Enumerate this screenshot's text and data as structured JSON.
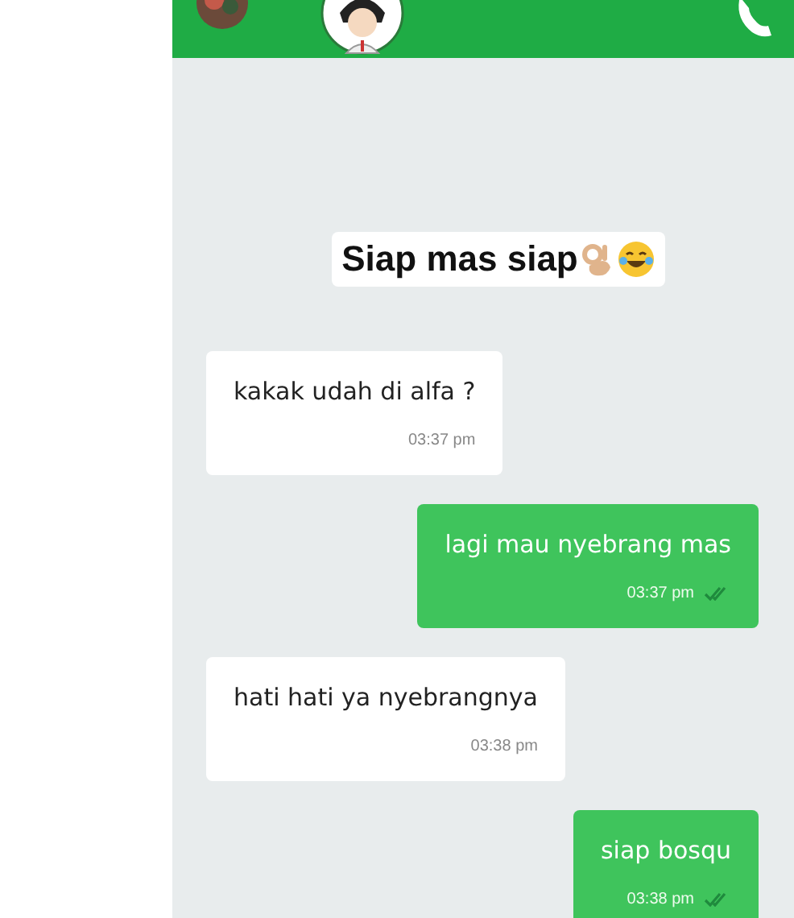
{
  "caption": {
    "text": "Siap mas siap"
  },
  "messages": [
    {
      "kind": "incoming",
      "text": "kakak udah di alfa ?",
      "time": "03:37 pm"
    },
    {
      "kind": "outgoing",
      "text": "lagi mau nyebrang mas",
      "time": "03:37 pm",
      "read": true
    },
    {
      "kind": "incoming",
      "text": "hati hati ya nyebrangnya",
      "time": "03:38 pm"
    },
    {
      "kind": "outgoing",
      "text": "siap bosqu",
      "time": "03:38 pm",
      "read": true
    }
  ]
}
